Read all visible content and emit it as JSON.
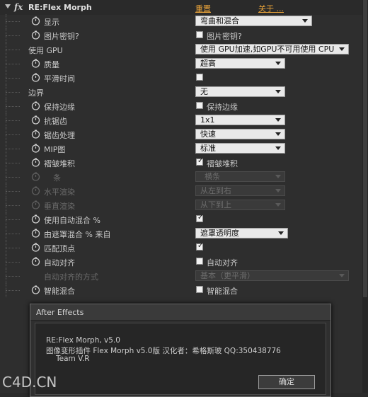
{
  "header": {
    "title": "RE:Flex Morph",
    "reset": "重置",
    "about": "关于 ..."
  },
  "rows": {
    "display": {
      "label": "显示",
      "value": "弯曲和混合"
    },
    "image_key": {
      "label": "图片密钥?",
      "check": "图片密钥?"
    },
    "use_gpu": {
      "label": "使用 GPU",
      "value": "使用 GPU加速,如GPU不可用使用 CPU"
    },
    "quality": {
      "label": "质量",
      "value": "超高"
    },
    "smooth_time": {
      "label": "平滑时间"
    },
    "border": {
      "label": "边界",
      "value": "无"
    },
    "keep_edge": {
      "label": "保持边缘",
      "check": "保持边缘"
    },
    "antialias": {
      "label": "抗锯齿",
      "value": "1x1"
    },
    "aa_proc": {
      "label": "锯齿处理",
      "value": "快速"
    },
    "mip": {
      "label": "MIP图",
      "value": "标准"
    },
    "pleat": {
      "label": "褶皱堆积",
      "check": "褶皱堆积"
    },
    "bar": {
      "label": "条",
      "value": "横条"
    },
    "h_render": {
      "label": "水平渲染",
      "value": "从左到右"
    },
    "v_render": {
      "label": "垂直渲染",
      "value": "从下到上"
    },
    "auto_blend": {
      "label": "使用自动混合  %"
    },
    "mask_blend": {
      "label": "由遮罩混合 % 来自",
      "value": "遮罩透明度"
    },
    "match_vertex": {
      "label": "匹配顶点"
    },
    "auto_align": {
      "label": "自动对齐",
      "check": "自动对齐"
    },
    "align_method": {
      "label": "自动对齐的方式",
      "value": "基本（更平滑）"
    },
    "smart_blend": {
      "label": "智能混合",
      "check": "智能混合"
    }
  },
  "dialog": {
    "title": "After Effects",
    "line1": "RE:Flex Morph, v5.0",
    "line2": "图像变形插件 Flex Morph v5.0版  汉化者：希格斯玻  QQ:350438776",
    "line3": "Team V.R",
    "ok": "确定"
  },
  "watermark": "C4D.CN"
}
